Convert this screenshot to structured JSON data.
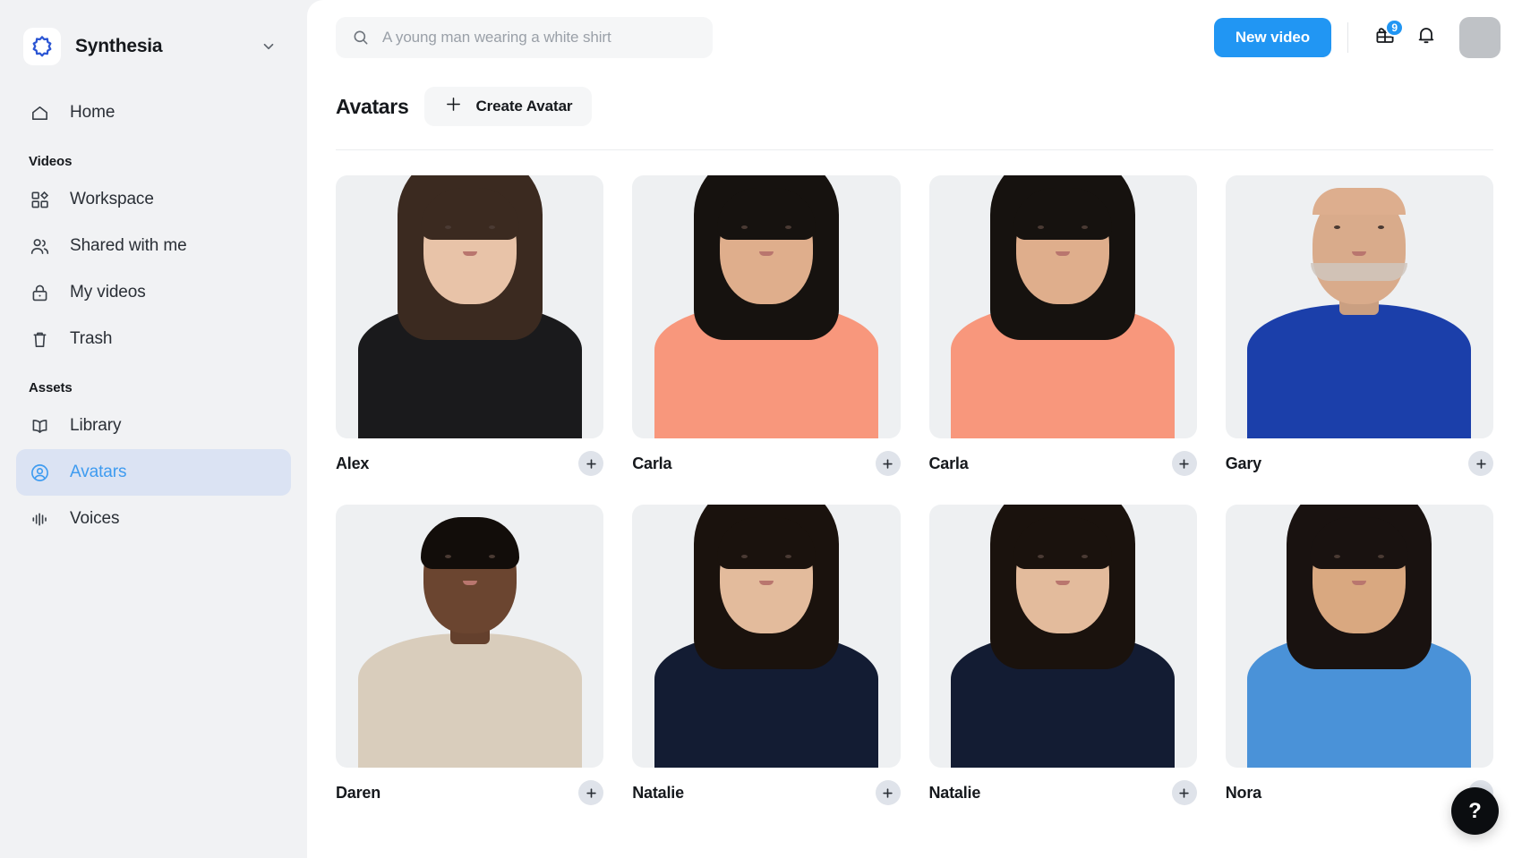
{
  "sidebar": {
    "brand": {
      "name": "Synthesia",
      "logo_icon": "synthesia-logo-icon",
      "caret_icon": "chevron-down-icon"
    },
    "top_items": [
      {
        "label": "Home",
        "icon": "home-icon",
        "active": false
      }
    ],
    "sections": [
      {
        "title": "Videos",
        "items": [
          {
            "label": "Workspace",
            "icon": "workspace-grid-icon",
            "active": false
          },
          {
            "label": "Shared with me",
            "icon": "users-icon",
            "active": false
          },
          {
            "label": "My videos",
            "icon": "lock-icon",
            "active": false
          },
          {
            "label": "Trash",
            "icon": "trash-icon",
            "active": false
          }
        ]
      },
      {
        "title": "Assets",
        "items": [
          {
            "label": "Library",
            "icon": "book-icon",
            "active": false
          },
          {
            "label": "Avatars",
            "icon": "user-circle-icon",
            "active": true
          },
          {
            "label": "Voices",
            "icon": "waveform-icon",
            "active": false
          }
        ]
      }
    ]
  },
  "topbar": {
    "search": {
      "placeholder": "A young man wearing a white shirt",
      "value": "",
      "icon": "search-icon"
    },
    "new_video_label": "New video",
    "gift": {
      "icon": "gift-icon",
      "badge": "9"
    },
    "notifications": {
      "icon": "bell-icon"
    },
    "user_avatar": {
      "icon": "avatar-placeholder"
    }
  },
  "page": {
    "title": "Avatars",
    "create_button": {
      "label": "Create Avatar",
      "icon": "plus-icon"
    }
  },
  "avatars": [
    {
      "name": "Alex",
      "add_icon": "plus-circle-icon",
      "skin": "#e8c3a8",
      "hair": "#3b2a20",
      "hair_style": "long-straight",
      "outfit": "#1a1a1c"
    },
    {
      "name": "Carla",
      "add_icon": "plus-circle-icon",
      "skin": "#dfae8c",
      "hair": "#16120f",
      "hair_style": "wavy",
      "outfit": "#f8977c"
    },
    {
      "name": "Carla",
      "add_icon": "plus-circle-icon",
      "skin": "#dfae8c",
      "hair": "#16120f",
      "hair_style": "wavy",
      "outfit": "#f8977c"
    },
    {
      "name": "Gary",
      "add_icon": "plus-circle-icon",
      "skin": "#d9ab8b",
      "hair": "#cfc6bd",
      "hair_style": "bald",
      "outfit": "#1b3faa"
    },
    {
      "name": "Daren",
      "add_icon": "plus-circle-icon",
      "skin": "#6b4530",
      "hair": "#120d0a",
      "hair_style": "short",
      "outfit": "#d9cdbc"
    },
    {
      "name": "Natalie",
      "add_icon": "plus-circle-icon",
      "skin": "#e3bb9c",
      "hair": "#1a120d",
      "hair_style": "long-straight",
      "outfit": "#131c33"
    },
    {
      "name": "Natalie",
      "add_icon": "plus-circle-icon",
      "skin": "#e3bb9c",
      "hair": "#1a120d",
      "hair_style": "long-straight",
      "outfit": "#131c33"
    },
    {
      "name": "Nora",
      "add_icon": "plus-circle-icon",
      "skin": "#d9a880",
      "hair": "#191210",
      "hair_style": "long-straight",
      "outfit": "#4a92d8"
    }
  ],
  "help": {
    "label": "?"
  },
  "colors": {
    "accent": "#2196f3",
    "sidebar_bg": "#f1f2f4",
    "active_item_bg": "#dbe3f3",
    "active_item_text": "#3e9bf0",
    "card_bg": "#eef0f2",
    "help_bg": "#0b0d10"
  }
}
